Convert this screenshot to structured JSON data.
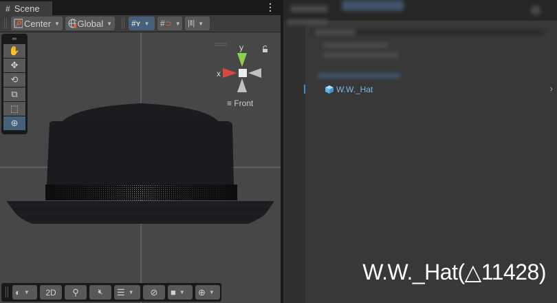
{
  "scene_tab": {
    "icon": "grid-icon",
    "label": "Scene",
    "menu_icon": "kebab-menu-icon"
  },
  "toolbar": {
    "pivot_label": "Center",
    "space_label": "Global"
  },
  "tool_palette": [
    "hand-tool",
    "move-tool",
    "rotate-tool",
    "scale-tool",
    "rect-tool",
    "transform-tool"
  ],
  "gizmo": {
    "x_label": "x",
    "y_label": "y",
    "view_label": "Front",
    "colors": {
      "x": "#d9473f",
      "y": "#8fd14a",
      "neutral": "#c8c8c8"
    }
  },
  "bottom_toolbar": {
    "mode_2d": "2D"
  },
  "hierarchy": {
    "selected_item": "W.W._Hat",
    "accent": "#3a8fd0"
  },
  "overlay_caption": "W.W._Hat(△11428)"
}
